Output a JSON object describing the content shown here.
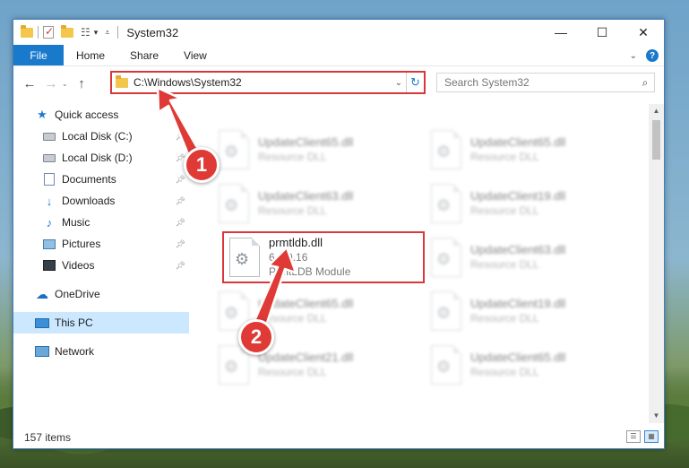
{
  "window": {
    "title": "System32",
    "controls": [
      "minimize-icon",
      "maximize-icon",
      "close-icon"
    ]
  },
  "ribbon": {
    "file_tab": "File",
    "tabs": [
      "Home",
      "Share",
      "View"
    ]
  },
  "address": {
    "path": "C:\\Windows\\System32",
    "search_placeholder": "Search System32"
  },
  "sidebar": {
    "quick_access": "Quick access",
    "items": [
      {
        "label": "Local Disk (C:)",
        "icon": "disk-icon",
        "pinned": true
      },
      {
        "label": "Local Disk (D:)",
        "icon": "disk-icon",
        "pinned": true
      },
      {
        "label": "Documents",
        "icon": "documents-icon",
        "pinned": true
      },
      {
        "label": "Downloads",
        "icon": "downloads-icon",
        "pinned": true
      },
      {
        "label": "Music",
        "icon": "music-icon",
        "pinned": true
      },
      {
        "label": "Pictures",
        "icon": "pictures-icon",
        "pinned": true
      },
      {
        "label": "Videos",
        "icon": "videos-icon",
        "pinned": true
      }
    ],
    "onedrive": "OneDrive",
    "this_pc": "This PC",
    "network": "Network"
  },
  "files": {
    "f1": {
      "name": "UpdateClient65.dll",
      "type": "Resource DLL"
    },
    "f2": {
      "name": "UpdateClient65.dll",
      "type": "Resource DLL"
    },
    "f3": {
      "name": "UpdateClient63.dll",
      "type": "Resource DLL"
    },
    "f4": {
      "name": "UpdateClient19.dll",
      "type": "Resource DLL"
    },
    "target": {
      "name": "prmtldb.dll",
      "version": "6.0.0.16",
      "type": "PrmtLDB Module"
    },
    "f6": {
      "name": "UpdateClient63.dll",
      "type": "Resource DLL"
    },
    "f7": {
      "name": "UpdateClient65.dll",
      "type": "Resource DLL"
    },
    "f8": {
      "name": "UpdateClient19.dll",
      "type": "Resource DLL"
    },
    "f9": {
      "name": "UpdateClient21.dll",
      "type": "Resource DLL"
    },
    "f10": {
      "name": "UpdateClient65.dll",
      "type": "Resource DLL"
    }
  },
  "status": {
    "item_count": "157 items"
  },
  "annotations": {
    "step1": "1",
    "step2": "2",
    "color": "#e03a36"
  },
  "colors": {
    "accent": "#1979ca",
    "highlight": "#d9373a",
    "selection": "#cce8ff"
  }
}
